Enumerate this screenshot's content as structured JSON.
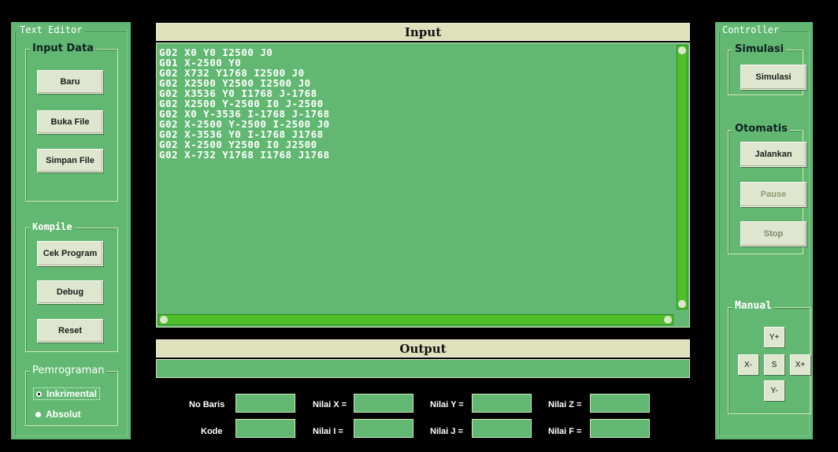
{
  "text_editor": {
    "title": "Text Editor",
    "input_data": {
      "title": "Input Data",
      "baru": "Baru",
      "buka_file": "Buka File",
      "simpan_file": "Simpan File"
    },
    "kompile": {
      "title": "Kompile",
      "cek_program": "Cek Program",
      "debug": "Debug",
      "reset": "Reset"
    },
    "pemrograman": {
      "title": "Pemrograman",
      "options": [
        "Inkrimental",
        "Absolut"
      ],
      "selected": "Inkrimental"
    }
  },
  "input": {
    "title": "Input",
    "lines": [
      "G02 X0 Y0 I2500 J0",
      "G01 X-2500 Y0",
      "G02 X732 Y1768 I2500 J0",
      "G02 X2500 Y2500 I2500 J0",
      "G02 X3536 Y0 I1768 J-1768",
      "G02 X2500 Y-2500 I0 J-2500",
      "G02 X0 Y-3536 I-1768 J-1768",
      "G02 X-2500 Y-2500 I-2500 J0",
      "G02 X-3536 Y0 I-1768 J1768",
      "G02 X-2500 Y2500 I0 J2500",
      "G02 X-732 Y1768 I1768 J1768"
    ]
  },
  "output": {
    "title": "Output",
    "value": ""
  },
  "fields": {
    "no_baris": "No Baris",
    "kode": "Kode",
    "nilai_x": "Nilai X =",
    "nilai_i": "Nilai I =",
    "nilai_y": "Nilai Y =",
    "nilai_j": "Nilai J =",
    "nilai_z": "Nilai Z =",
    "nilai_f": "Nilai F ="
  },
  "controller": {
    "title": "Controller",
    "simulasi": {
      "title": "Simulasi",
      "button": "Simulasi"
    },
    "otomatis": {
      "title": "Otomatis",
      "jalankan": "Jalankan",
      "pause": "Pause",
      "stop": "Stop"
    },
    "manual": {
      "title": "Manual",
      "y_plus": "Y+",
      "x_minus": "X-",
      "s": "S",
      "x_plus": "X+",
      "y_minus": "Y-"
    }
  },
  "colors": {
    "panel": "#62b873",
    "header": "#dfe0bc",
    "scroll": "#4fbf2a"
  }
}
